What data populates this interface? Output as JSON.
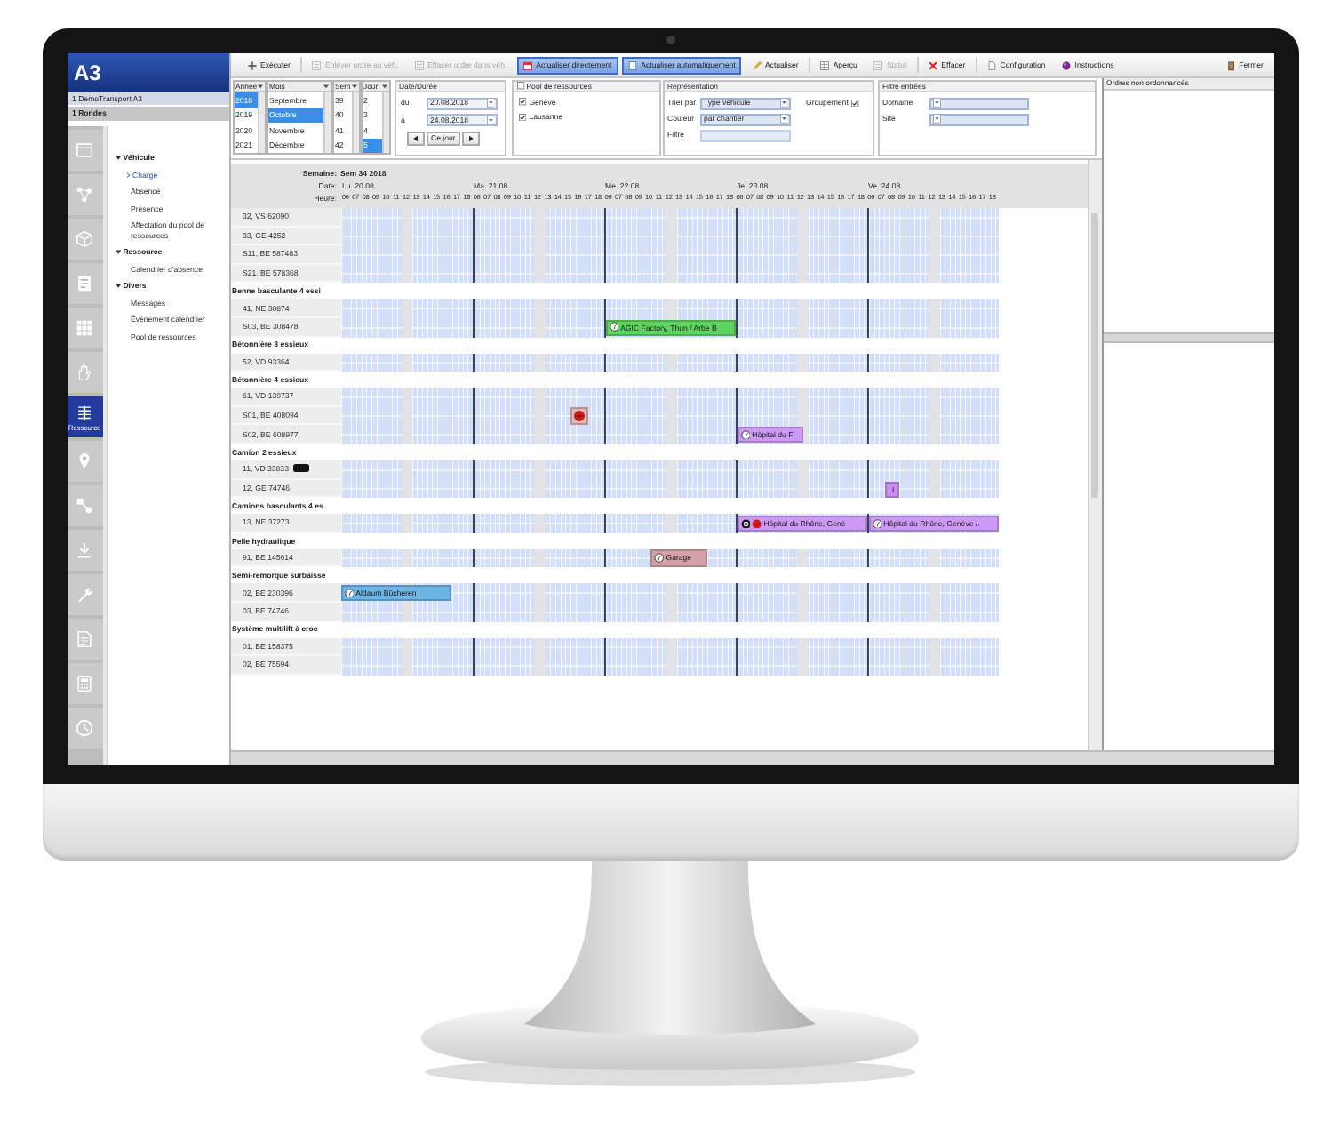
{
  "app": {
    "logo": "A3",
    "context": [
      {
        "label": "1 DemoTransport A3"
      },
      {
        "label": "1 Rondes"
      }
    ]
  },
  "modules": [
    {
      "selected": false
    },
    {
      "selected": false
    },
    {
      "selected": false
    },
    {
      "selected": false
    },
    {
      "selected": false
    },
    {
      "selected": false
    },
    {
      "label": "Ressource",
      "selected": true
    },
    {
      "selected": false
    },
    {
      "selected": false
    },
    {
      "selected": false
    },
    {
      "selected": false
    },
    {
      "selected": false
    },
    {
      "selected": false
    },
    {
      "selected": false
    }
  ],
  "nav": [
    {
      "label": "Véhicule",
      "expanded": true,
      "children": [
        {
          "label": "Charge",
          "selected": true
        },
        {
          "label": "Absence",
          "selected": false
        },
        {
          "label": "Présence",
          "selected": false
        },
        {
          "label": "Affectation du pool de ressources",
          "selected": false
        }
      ]
    },
    {
      "label": "Ressource",
      "expanded": true,
      "children": [
        {
          "label": "Calendrier d'absence",
          "selected": false
        }
      ]
    },
    {
      "label": "Divers",
      "expanded": true,
      "children": [
        {
          "label": "Messages",
          "selected": false
        },
        {
          "label": "Événement calendrier",
          "selected": false
        },
        {
          "label": "Pool de ressources",
          "selected": false
        }
      ]
    }
  ],
  "toolbar": [
    {
      "label": "Exécuter",
      "disabled": false,
      "on": false
    },
    {
      "label": "Enlever ordre au véh.",
      "disabled": true,
      "on": false
    },
    {
      "label": "Effacer ordre dans véh.",
      "disabled": true,
      "on": false
    },
    {
      "label": "Actualiser directement",
      "disabled": false,
      "on": true
    },
    {
      "label": "Actualiser automatiquement",
      "disabled": false,
      "on": true
    },
    {
      "label": "Actualiser",
      "disabled": false,
      "on": false
    },
    {
      "label": "Aperçu",
      "disabled": false,
      "on": false
    },
    {
      "label": "Statut",
      "disabled": true,
      "on": false
    },
    {
      "label": "Effacer",
      "disabled": false,
      "on": false
    },
    {
      "label": "Configuration",
      "disabled": false,
      "on": false
    },
    {
      "label": "Instructions",
      "disabled": false,
      "on": false
    },
    {
      "label": "Fermer",
      "disabled": false,
      "on": false
    }
  ],
  "date_filter": {
    "lists": [
      {
        "title": "Année",
        "options": [
          {
            "label": "2018",
            "selected": true
          },
          {
            "label": "2019",
            "selected": false
          },
          {
            "label": "2020",
            "selected": false
          },
          {
            "label": "2021",
            "selected": false
          }
        ]
      },
      {
        "title": "Mois",
        "options": [
          {
            "label": "Septembre",
            "selected": false
          },
          {
            "label": "Octobre",
            "selected": true
          },
          {
            "label": "Novembre",
            "selected": false
          },
          {
            "label": "Décembre",
            "selected": false
          }
        ]
      },
      {
        "title": "Sem",
        "options": [
          {
            "label": "39",
            "selected": false
          },
          {
            "label": "40",
            "selected": false
          },
          {
            "label": "41",
            "selected": false
          },
          {
            "label": "42",
            "selected": false
          }
        ]
      },
      {
        "title": "Jour",
        "options": [
          {
            "label": "2",
            "selected": false
          },
          {
            "label": "3",
            "selected": false
          },
          {
            "label": "4",
            "selected": false
          },
          {
            "label": "5",
            "selected": true
          }
        ]
      }
    ],
    "period": {
      "title": "Date/Durée",
      "from_label": "du",
      "from": "20.08.2018",
      "to_label": "à",
      "to": "24.08.2018",
      "today": "Ce jour"
    }
  },
  "pool": {
    "title": "Pool de ressources",
    "checked": false,
    "sites": [
      {
        "label": "Genève",
        "checked": true
      },
      {
        "label": "Lausanne",
        "checked": true
      }
    ]
  },
  "representation": {
    "title": "Représentation",
    "sort_label": "Trier par",
    "sort": "Type véhicule",
    "color_label": "Couleur",
    "color_mode": "par chantier",
    "filter_label": "Filtre",
    "grouping_label": "Groupement",
    "grouping": true
  },
  "entry_filter": {
    "title": "Filtre entrées",
    "fields": [
      {
        "label": "Domaine"
      },
      {
        "label": "Site"
      }
    ]
  },
  "unscheduled": {
    "title": "Ordres non ordonnancés"
  },
  "schedule": {
    "week_label": "Semaine:",
    "week": "Sem 34 2018",
    "date_label": "Date:",
    "hour_label": "Heure:",
    "days": [
      {
        "label": "Lu. 20.08",
        "hours": [
          "06",
          "07",
          "08",
          "09",
          "10",
          "11",
          "12",
          "13",
          "14",
          "15",
          "16",
          "17",
          "18"
        ]
      },
      {
        "label": "Ma. 21.08",
        "hours": [
          "06",
          "07",
          "08",
          "09",
          "10",
          "11",
          "12",
          "13",
          "14",
          "15",
          "16",
          "17",
          "18"
        ]
      },
      {
        "label": "Me. 22.08",
        "hours": [
          "06",
          "07",
          "08",
          "09",
          "10",
          "11",
          "12",
          "13",
          "14",
          "15",
          "16",
          "17",
          "18"
        ]
      },
      {
        "label": "Je. 23.08",
        "hours": [
          "06",
          "07",
          "08",
          "09",
          "10",
          "11",
          "12",
          "13",
          "14",
          "15",
          "16",
          "17",
          "18"
        ]
      },
      {
        "label": "Ve. 24.08",
        "hours": [
          "06",
          "07",
          "08",
          "09",
          "10",
          "11",
          "12",
          "13",
          "14",
          "15",
          "16",
          "17",
          "18"
        ]
      }
    ],
    "rows": [
      {
        "kind": "resource",
        "name": "32, VS 62090",
        "tagged": false
      },
      {
        "kind": "resource",
        "name": "33, GE 4252",
        "tagged": false
      },
      {
        "kind": "resource",
        "name": "S11, BE 587483",
        "tagged": false
      },
      {
        "kind": "resource",
        "name": "S21, BE 578368",
        "tagged": false
      },
      {
        "kind": "group",
        "name": "Benne basculante 4 essi"
      },
      {
        "kind": "resource",
        "name": "41, NE 30874",
        "tagged": false
      },
      {
        "kind": "resource",
        "name": "S03, BE 308478",
        "tagged": false,
        "wednesday": [
          {
            "kind": "order",
            "label": "AGIC Factory, Thun / Arbe B",
            "color": "#5fd35f",
            "flagged": false,
            "level": 1
          }
        ]
      },
      {
        "kind": "group",
        "name": "Bétonnière 3 essieux"
      },
      {
        "kind": "resource",
        "name": "52, VD 93364",
        "tagged": false
      },
      {
        "kind": "group",
        "name": "Bétonnière 4 essieux"
      },
      {
        "kind": "resource",
        "name": "61, VD 139737",
        "tagged": false
      },
      {
        "kind": "resource",
        "name": "S01, BE 408094",
        "tagged": false,
        "tuesday": [
          {
            "kind": "blocked",
            "color": "#e3b5b0",
            "level": 0.81
          }
        ]
      },
      {
        "kind": "resource",
        "name": "S02, BE 608977",
        "tagged": false,
        "thursday": [
          {
            "kind": "order",
            "label": "Hôpital du F",
            "color": "#cc99f5",
            "flagged": false,
            "level": 0.52
          }
        ]
      },
      {
        "kind": "group",
        "name": "Camion 2 essieux"
      },
      {
        "kind": "resource",
        "name": "11, VD 33833",
        "tagged": true
      },
      {
        "kind": "resource",
        "name": "12, GE 74746",
        "tagged": false,
        "friday": [
          {
            "kind": "marker",
            "color": "#c98ef0",
            "level": 0.19
          }
        ]
      },
      {
        "kind": "group",
        "name": "Camions basculants 4 es"
      },
      {
        "kind": "resource",
        "name": "13, NE 37273",
        "tagged": false,
        "thursday": [
          {
            "kind": "order",
            "label": "Hôpital du Rhône, Genè",
            "color": "#cc99f5",
            "flagged": true,
            "level": 1
          }
        ],
        "friday": [
          {
            "kind": "order",
            "label": "Hôpital du Rhône, Genève /.",
            "color": "#cc99f5",
            "flagged": false,
            "level": 1
          }
        ]
      },
      {
        "kind": "group",
        "name": "Pelle hydraulique"
      },
      {
        "kind": "resource",
        "name": "91, BE 145614",
        "tagged": false,
        "wednesday": [
          {
            "kind": "job",
            "label": "Garage",
            "color": "#d4a1a6",
            "flagged": false,
            "level": 0.57
          }
        ]
      },
      {
        "kind": "group",
        "name": "Semi-remorque surbaisse"
      },
      {
        "kind": "resource",
        "name": "02, BE 230396",
        "tagged": false,
        "monday": [
          {
            "kind": "order",
            "label": "Aldaum Bücheren",
            "color": "#6cb4e4",
            "flagged": false,
            "level": 0.85
          }
        ]
      },
      {
        "kind": "resource",
        "name": "03, BE 74746",
        "tagged": false
      },
      {
        "kind": "group",
        "name": "Système multilift à croc"
      },
      {
        "kind": "resource",
        "name": "01, BE 158375",
        "tagged": false
      },
      {
        "kind": "resource",
        "name": "02, BE 75594",
        "tagged": false
      }
    ]
  }
}
